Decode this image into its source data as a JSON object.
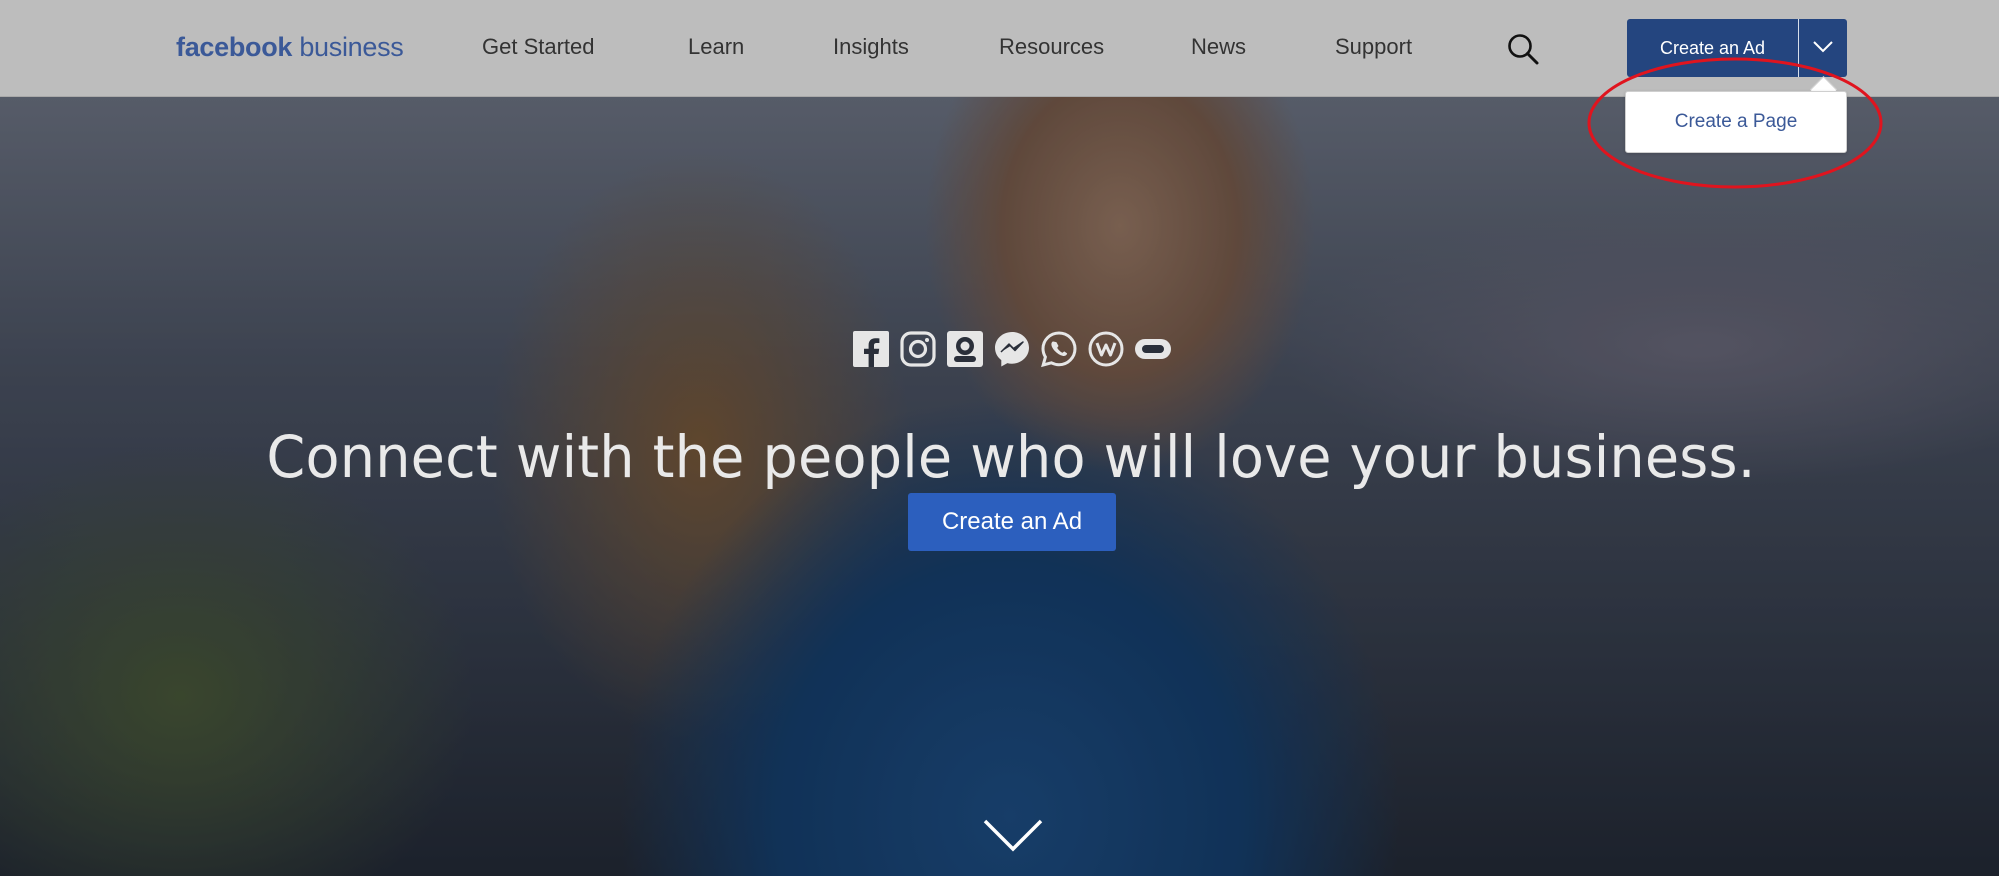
{
  "brand": {
    "logo_bold": "facebook",
    "logo_light": " business",
    "color": "#3b5998"
  },
  "nav": {
    "items": [
      {
        "label": "Get Started"
      },
      {
        "label": "Learn"
      },
      {
        "label": "Insights"
      },
      {
        "label": "Resources"
      },
      {
        "label": "News"
      },
      {
        "label": "Support"
      }
    ],
    "search_icon": "search-icon"
  },
  "cta": {
    "main_label": "Create an Ad",
    "toggle_icon": "chevron-down-icon",
    "color": "#24457f"
  },
  "dropdown": {
    "items": [
      {
        "label": "Create a Page"
      }
    ]
  },
  "annotation": {
    "shape": "ellipse",
    "color": "#e0141e"
  },
  "hero": {
    "platform_icons": [
      "facebook-icon",
      "instagram-icon",
      "audience-network-icon",
      "messenger-icon",
      "whatsapp-icon",
      "workplace-icon",
      "oculus-icon"
    ],
    "headline": "Connect with the people who will love your business.",
    "cta_label": "Create an Ad",
    "cta_color": "#2c5fbe",
    "scroll_icon": "chevron-down-icon"
  }
}
